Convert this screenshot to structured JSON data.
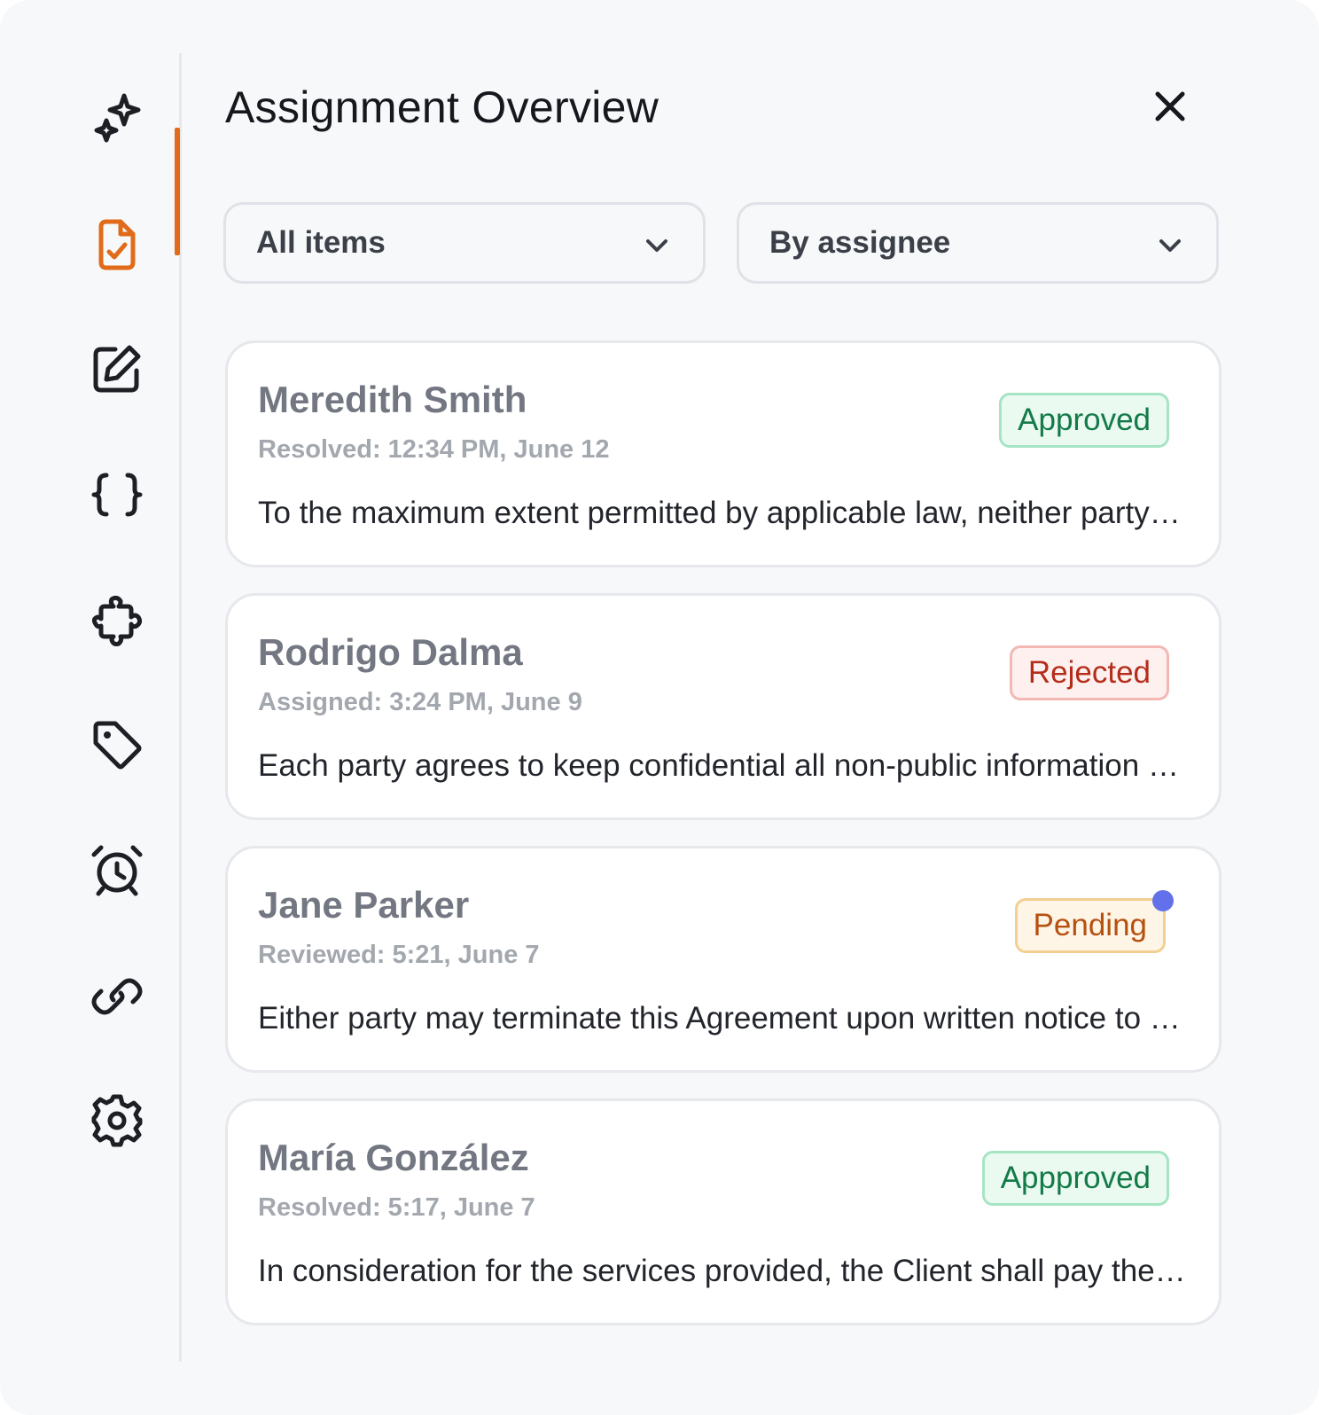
{
  "header": {
    "title": "Assignment Overview"
  },
  "sidebar": {
    "items": [
      {
        "icon": "sparkles-icon",
        "active": false
      },
      {
        "icon": "document-check-icon",
        "active": true
      },
      {
        "icon": "edit-icon",
        "active": false
      },
      {
        "icon": "braces-icon",
        "active": false
      },
      {
        "icon": "puzzle-icon",
        "active": false
      },
      {
        "icon": "tag-icon",
        "active": false
      },
      {
        "icon": "alarm-clock-icon",
        "active": false
      },
      {
        "icon": "link-icon",
        "active": false
      },
      {
        "icon": "gear-icon",
        "active": false
      }
    ],
    "active_color": "#e06b1a"
  },
  "filters": {
    "items_value": "All items",
    "group_value": "By assignee"
  },
  "cards": [
    {
      "name": "Meredith Smith",
      "meta": "Resolved: 12:34 PM, June 12",
      "status": "Approved",
      "status_color": "green",
      "snippet": "To the maximum extent permitted by applicable law, neither party shall be liable",
      "unread": false
    },
    {
      "name": "Rodrigo Dalma",
      "meta": "Assigned: 3:24 PM, June 9",
      "status": "Rejected",
      "status_color": "red",
      "snippet": "Each party agrees to keep confidential all non-public information disclosed",
      "unread": false
    },
    {
      "name": "Jane Parker",
      "meta": "Reviewed: 5:21, June 7",
      "status": "Pending",
      "status_color": "orange",
      "snippet": "Either party may terminate this Agreement upon written notice to the other party",
      "unread": true
    },
    {
      "name": "María González",
      "meta": "Resolved: 5:17, June 7",
      "status": "Appproved",
      "status_color": "green",
      "snippet": "In consideration for the services provided, the Client shall pay the Provider",
      "unread": false
    }
  ]
}
